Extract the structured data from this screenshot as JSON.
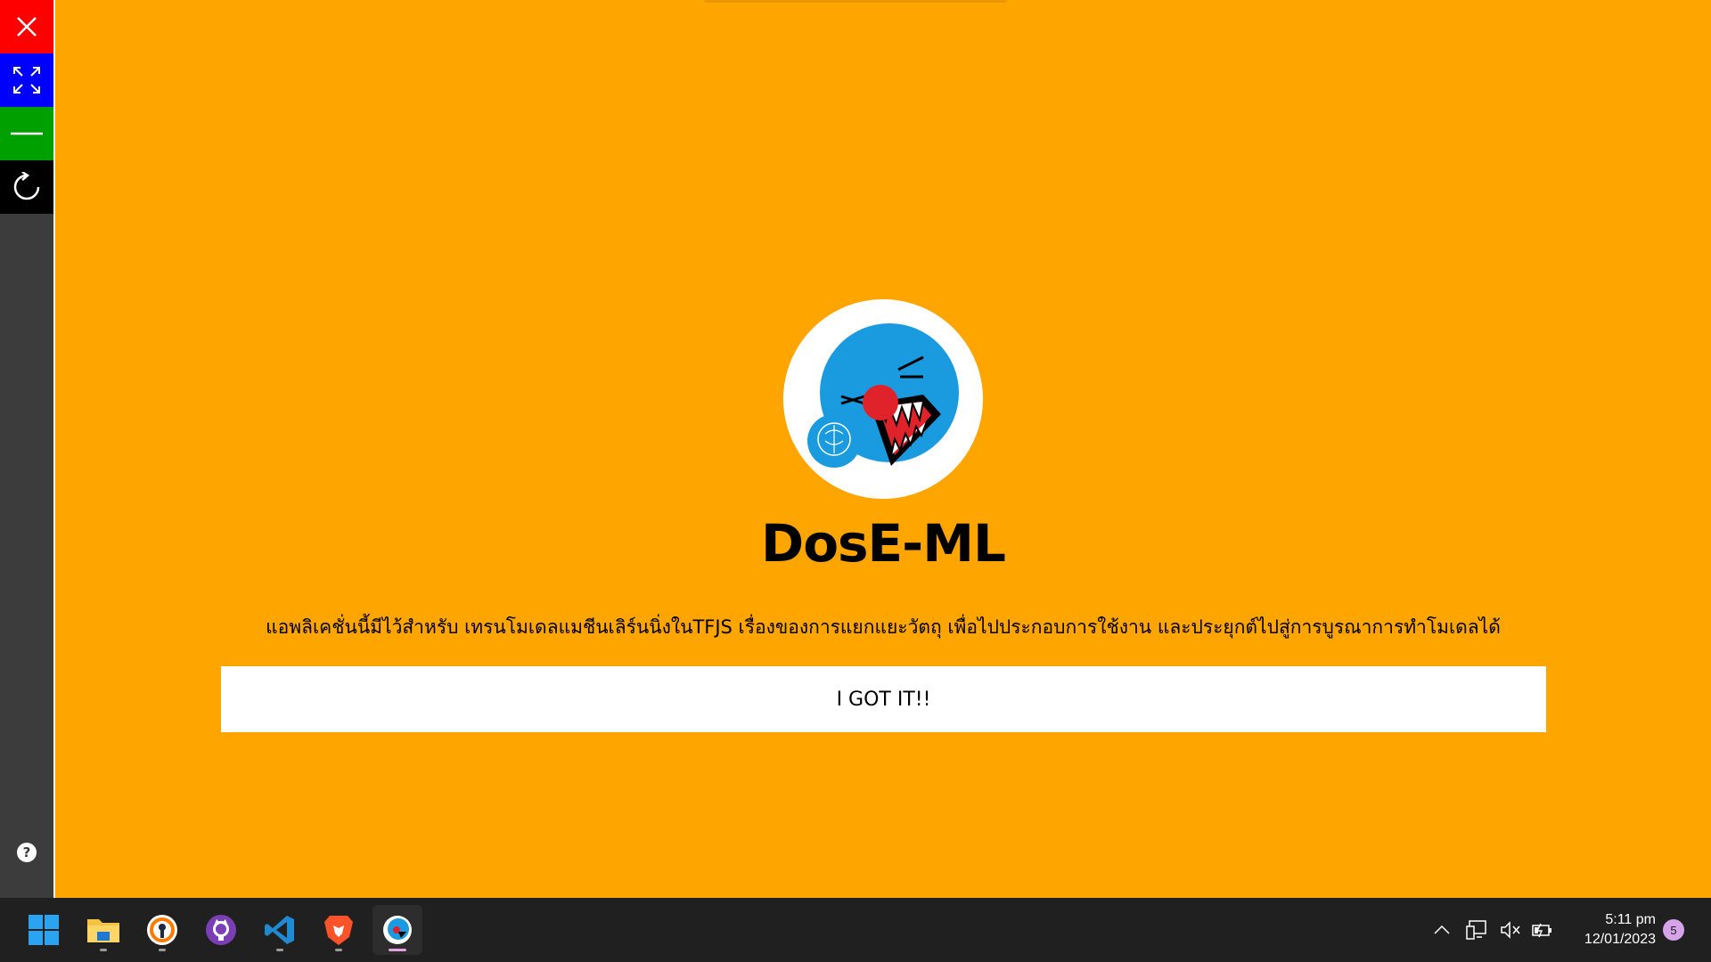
{
  "sidebar": {
    "close_icon": "close-icon",
    "maximize_icon": "expand-arrows-icon",
    "minimize_icon": "minus-icon",
    "reload_icon": "reload-icon",
    "help_label": "?",
    "colors": {
      "close": "#ff0000",
      "maximize": "#0000ff",
      "minimize": "#00a000",
      "reload": "#000000",
      "bg": "#3c3c3c"
    }
  },
  "main": {
    "background": "#ffa500",
    "title": "DosE-ML",
    "description": "แอพลิเคชั่นนี้มีไว้สำหรับ เทรนโมเดลแมชีนเลิร์นนิ่งในTFJS เรื่องของการแยกแยะวัตถุ เพื่อไปประกอบการใช้งาน และประยุกต์ไปสู่การบูรณาการทำโมเดลได้",
    "button_label": "I GOT IT!!",
    "logo_icon": "dose-ml-logo"
  },
  "taskbar": {
    "apps": [
      {
        "name": "start",
        "icon": "windows-icon"
      },
      {
        "name": "file-explorer",
        "icon": "folder-icon"
      },
      {
        "name": "app-keyhole",
        "icon": "keyhole-icon"
      },
      {
        "name": "github-desktop",
        "icon": "github-icon"
      },
      {
        "name": "vscode",
        "icon": "vscode-icon"
      },
      {
        "name": "brave",
        "icon": "brave-icon"
      },
      {
        "name": "dose-ml",
        "icon": "dose-ml-icon"
      }
    ],
    "tray_icons": [
      "chevron-up-icon",
      "network-icon",
      "mute-icon",
      "battery-icon"
    ],
    "time": "5:11 pm",
    "date": "12/01/2023",
    "notification_count": "5"
  }
}
